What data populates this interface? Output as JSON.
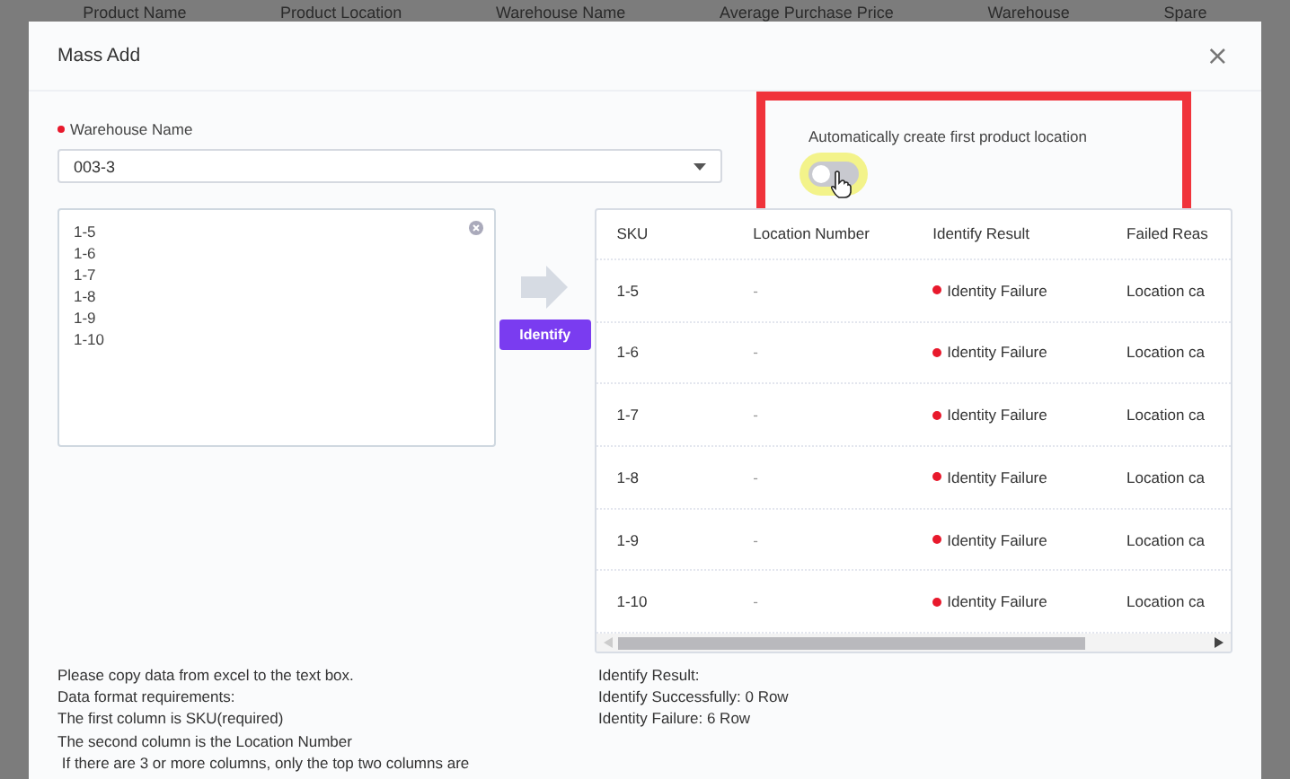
{
  "background_table": {
    "columns": [
      "Product Name",
      "Product Location",
      "Warehouse Name",
      "Average Purchase Price",
      "Warehouse",
      "Spare"
    ]
  },
  "dialog": {
    "title": "Mass Add",
    "close": "×"
  },
  "warehouse": {
    "label": "Warehouse Name",
    "required": true,
    "value": "003-3"
  },
  "auto_create": {
    "label": "Automatically create first product location",
    "on": false,
    "highlighted": true
  },
  "input_box": {
    "lines": [
      "1-5",
      "1-6",
      "1-7",
      "1-8",
      "1-9",
      "1-10"
    ]
  },
  "identify_button": "Identify",
  "table": {
    "columns": [
      "SKU",
      "Location Number",
      "Identify Result",
      "Failed Reas"
    ],
    "rows": [
      {
        "sku": "1-5",
        "location": "-",
        "result": "Identity Failure",
        "color": "#e8192c",
        "reason": "Location ca"
      },
      {
        "sku": "1-6",
        "location": "-",
        "result": "Identity Failure",
        "color": "#e8192c",
        "reason": "Location ca"
      },
      {
        "sku": "1-7",
        "location": "-",
        "result": "Identity Failure",
        "color": "#e8192c",
        "reason": "Location ca"
      },
      {
        "sku": "1-8",
        "location": "-",
        "result": "Identity Failure",
        "color": "#e8192c",
        "reason": "Location ca"
      },
      {
        "sku": "1-9",
        "location": "-",
        "result": "Identity Failure",
        "color": "#e8192c",
        "reason": "Location ca"
      },
      {
        "sku": "1-10",
        "location": "-",
        "result": "Identity Failure",
        "color": "#e8192c",
        "reason": "Location ca"
      }
    ]
  },
  "instructions": [
    "Please copy data from excel to the text box.",
    "Data format requirements:",
    "The first column is SKU(required)",
    "The second column is the Location Number",
    " If there are 3 or more columns, only the top two columns are"
  ],
  "summary": [
    "Identify Result:",
    "Identify Successfully: 0 Row",
    "Identity Failure: 6 Row"
  ]
}
